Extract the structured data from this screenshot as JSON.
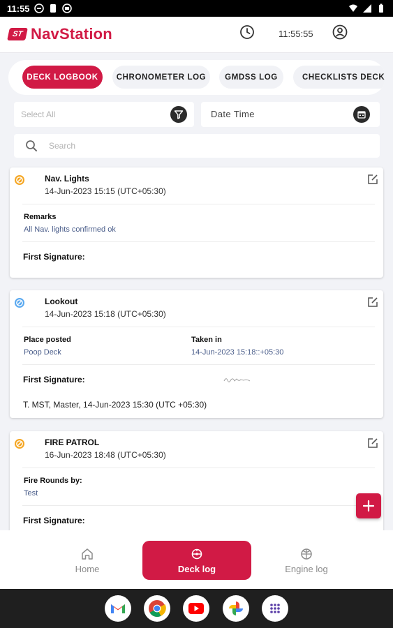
{
  "status_bar": {
    "time": "11:55"
  },
  "header": {
    "logo_badge": "ST",
    "app_name": "NavStation",
    "clock_time": "11:55:55"
  },
  "tabs": [
    {
      "label": "DECK LOGBOOK",
      "active": true
    },
    {
      "label": "CHRONOMETER LOG",
      "active": false
    },
    {
      "label": "GMDSS LOG",
      "active": false
    },
    {
      "label": "CHECKLISTS DECK",
      "active": false
    }
  ],
  "filters": {
    "select_all_placeholder": "Select All",
    "date_time_label": "Date Time",
    "search_placeholder": "Search"
  },
  "entries": [
    {
      "title": "Nav. Lights",
      "timestamp": "14-Jun-2023 15:15 (UTC+05:30)",
      "status_color": "#f5a623",
      "fields": [
        {
          "label": "Remarks",
          "value": "All Nav. lights confirmed ok"
        }
      ],
      "signature_label": "First Signature:",
      "signature_text": ""
    },
    {
      "title": "Lookout",
      "timestamp": "14-Jun-2023 15:18 (UTC+05:30)",
      "status_color": "#5aa9f0",
      "fields": [
        {
          "label": "Place posted",
          "value": "Poop Deck"
        },
        {
          "label": "Taken in",
          "value": "14-Jun-2023 15:18::+05:30"
        }
      ],
      "signature_label": "First Signature:",
      "signature_text": "T. MST, Master, 14-Jun-2023 15:30 (UTC +05:30)"
    },
    {
      "title": "FIRE PATROL",
      "timestamp": "16-Jun-2023 18:48 (UTC+05:30)",
      "status_color": "#f5a623",
      "fields": [
        {
          "label": "Fire Rounds by:",
          "value": "Test"
        }
      ],
      "signature_label": "First Signature:",
      "signature_text": ""
    }
  ],
  "fab": {
    "icon": "plus-icon"
  },
  "bottom_nav": [
    {
      "label": "Home",
      "icon": "home-icon",
      "active": false
    },
    {
      "label": "Deck log",
      "icon": "ship-wheel-icon",
      "active": true
    },
    {
      "label": "Engine log",
      "icon": "engine-icon",
      "active": false
    }
  ],
  "dock_apps": [
    "gmail-icon",
    "chrome-icon",
    "youtube-icon",
    "photos-icon",
    "app-drawer-icon"
  ],
  "colors": {
    "brand": "#d11a45",
    "pending_status": "#f5a623",
    "completed_status": "#5aa9f0",
    "background": "#f2f3f7"
  }
}
